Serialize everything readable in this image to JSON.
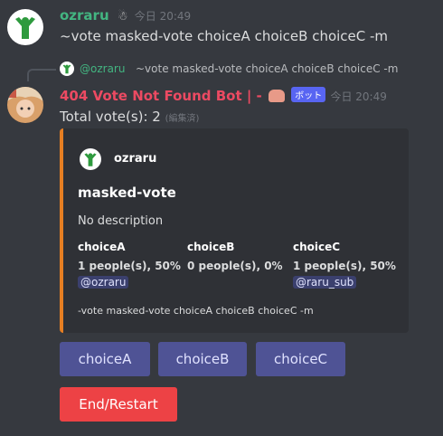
{
  "message1": {
    "author": "ozraru",
    "timestamp": "今日 20:49",
    "content": "~vote masked-vote choiceA choiceB choiceC -m"
  },
  "reply": {
    "author": "@ozraru",
    "content": "~vote masked-vote choiceA choiceB choiceC -m"
  },
  "message2": {
    "author": "404 Vote Not Found Bot | -",
    "badge": "ボット",
    "timestamp": "今日 20:49",
    "content": "Total vote(s): 2",
    "edited": "(編集済)"
  },
  "embed": {
    "author": "ozraru",
    "title": "masked-vote",
    "description": "No description",
    "fields": [
      {
        "name": "choiceA",
        "value": "1 people(s), 50%",
        "mention": "@ozraru"
      },
      {
        "name": "choiceB",
        "value": "0 people(s), 0%",
        "mention": ""
      },
      {
        "name": "choiceC",
        "value": "1 people(s), 50%",
        "mention": "@raru_sub"
      }
    ],
    "footer": "-vote masked-vote choiceA choiceB choiceC -m",
    "accent_color": "#e67e22"
  },
  "buttons": {
    "choiceA": "choiceA",
    "choiceB": "choiceB",
    "choiceC": "choiceC",
    "end": "End/Restart"
  },
  "colors": {
    "background": "#36393f",
    "username_green": "#43b581",
    "bot_name": "#ec4a62",
    "bot_badge": "#5865f2",
    "button_blurple": "#4f5395",
    "button_red": "#ed4245"
  }
}
